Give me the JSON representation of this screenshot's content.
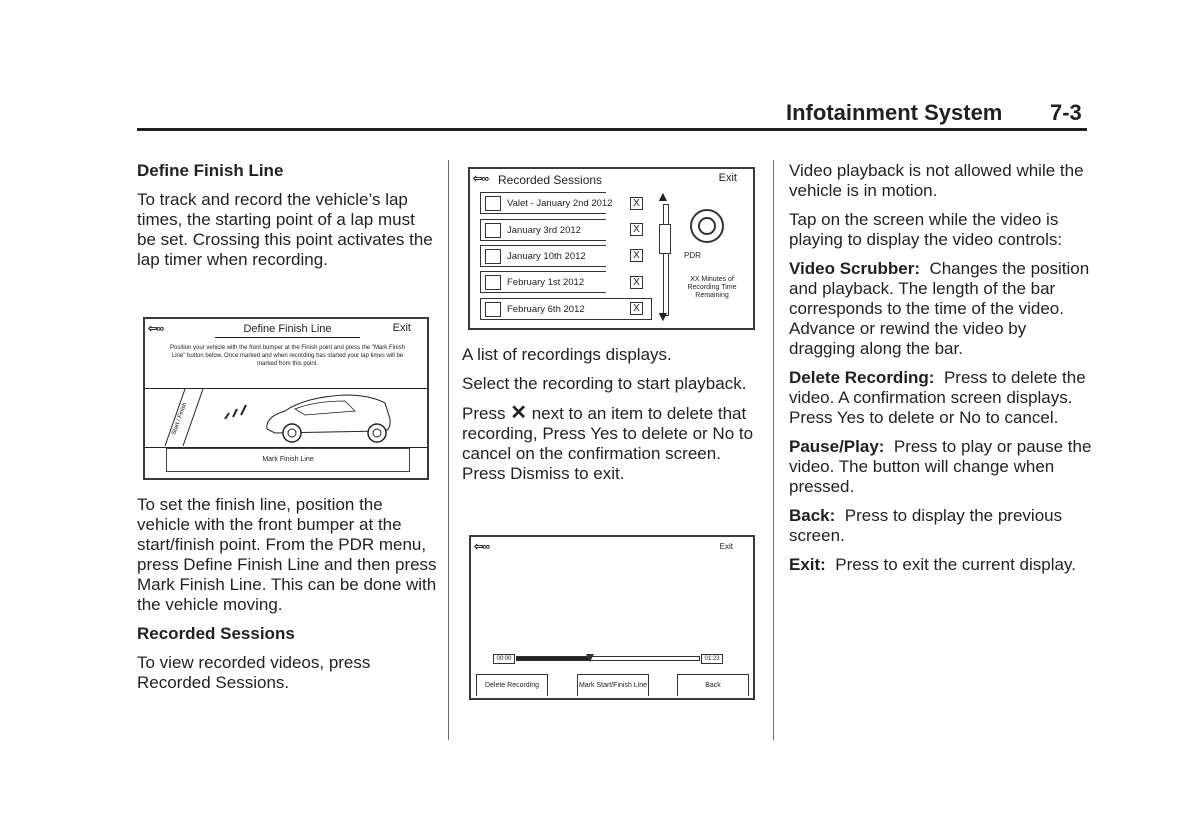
{
  "header": {
    "section_title": "Infotainment System",
    "page_number": "7-3"
  },
  "column1": {
    "heading1": "Define Finish Line",
    "para1": "To track and record the vehicle’s lap times, the starting point of a lap must be set. Crossing this point activates the lap timer when recording.",
    "screen": {
      "back_label": "⇦∞",
      "title": "Define Finish Line",
      "exit_label": "Exit",
      "instructions": "Position your vehicle with the front bumper at the Finish point and press the \"Mark Finish Line\" button below. Once marked and when recording has started your lap times will be marked from this point.",
      "road_marker": "Start / Finish",
      "mark_button": "Mark Finish Line"
    },
    "para2": "To set the finish line, position the vehicle with the front bumper at the start/finish point. From the PDR menu, press Define Finish Line and then press Mark Finish Line. This can be done with the vehicle moving.",
    "heading2": "Recorded Sessions",
    "para3": "To view recorded videos, press Recorded Sessions."
  },
  "column2": {
    "screen": {
      "back_label": "⇦∞",
      "title": "Recorded Sessions",
      "exit_label": "Exit",
      "recordings": [
        {
          "label": "Valet - January 2nd 2012"
        },
        {
          "label": "January 3rd 2012"
        },
        {
          "label": "January 10th 2012"
        },
        {
          "label": "February 1st 2012"
        },
        {
          "label": "February 6th 2012"
        }
      ],
      "delete_label": "X",
      "pdr_label": "PDR",
      "remaining_text": "XX Minutes of Recording Time Remaining"
    },
    "para1": "A list of recordings displays.",
    "para2": "Select the recording to start playback.",
    "para3_pre": "Press",
    "para3_icon": "✕",
    "para3_post": "next to an item to delete that recording, Press Yes to delete or No to cancel on the confirmation screen. Press Dismiss to exit.",
    "playback_screen": {
      "back_label": "⇦∞",
      "exit_label": "Exit",
      "time_start": "00:00",
      "time_end": "01:23",
      "progress_fraction": 0.4,
      "buttons": [
        "Delete Recording",
        "Mark Start/Finish Line",
        "Back"
      ]
    }
  },
  "column3": {
    "para1": "Video playback is not allowed while the vehicle is in motion.",
    "para2": "Tap on the screen while the video is playing to display the video controls:",
    "items": [
      {
        "term": "Video Scrubber:",
        "desc": "Changes the position and playback. The length of the bar corresponds to the time of the video. Advance or rewind the video by dragging along the bar."
      },
      {
        "term": "Delete Recording:",
        "desc": "Press to delete the video. A confirmation screen displays. Press Yes to delete or No to cancel."
      },
      {
        "term": "Pause/Play:",
        "desc": "Press to play or pause the video. The button will change when pressed."
      },
      {
        "term": "Back:",
        "desc": "Press to display the previous screen."
      },
      {
        "term": "Exit:",
        "desc": "Press to exit the current display."
      }
    ]
  }
}
